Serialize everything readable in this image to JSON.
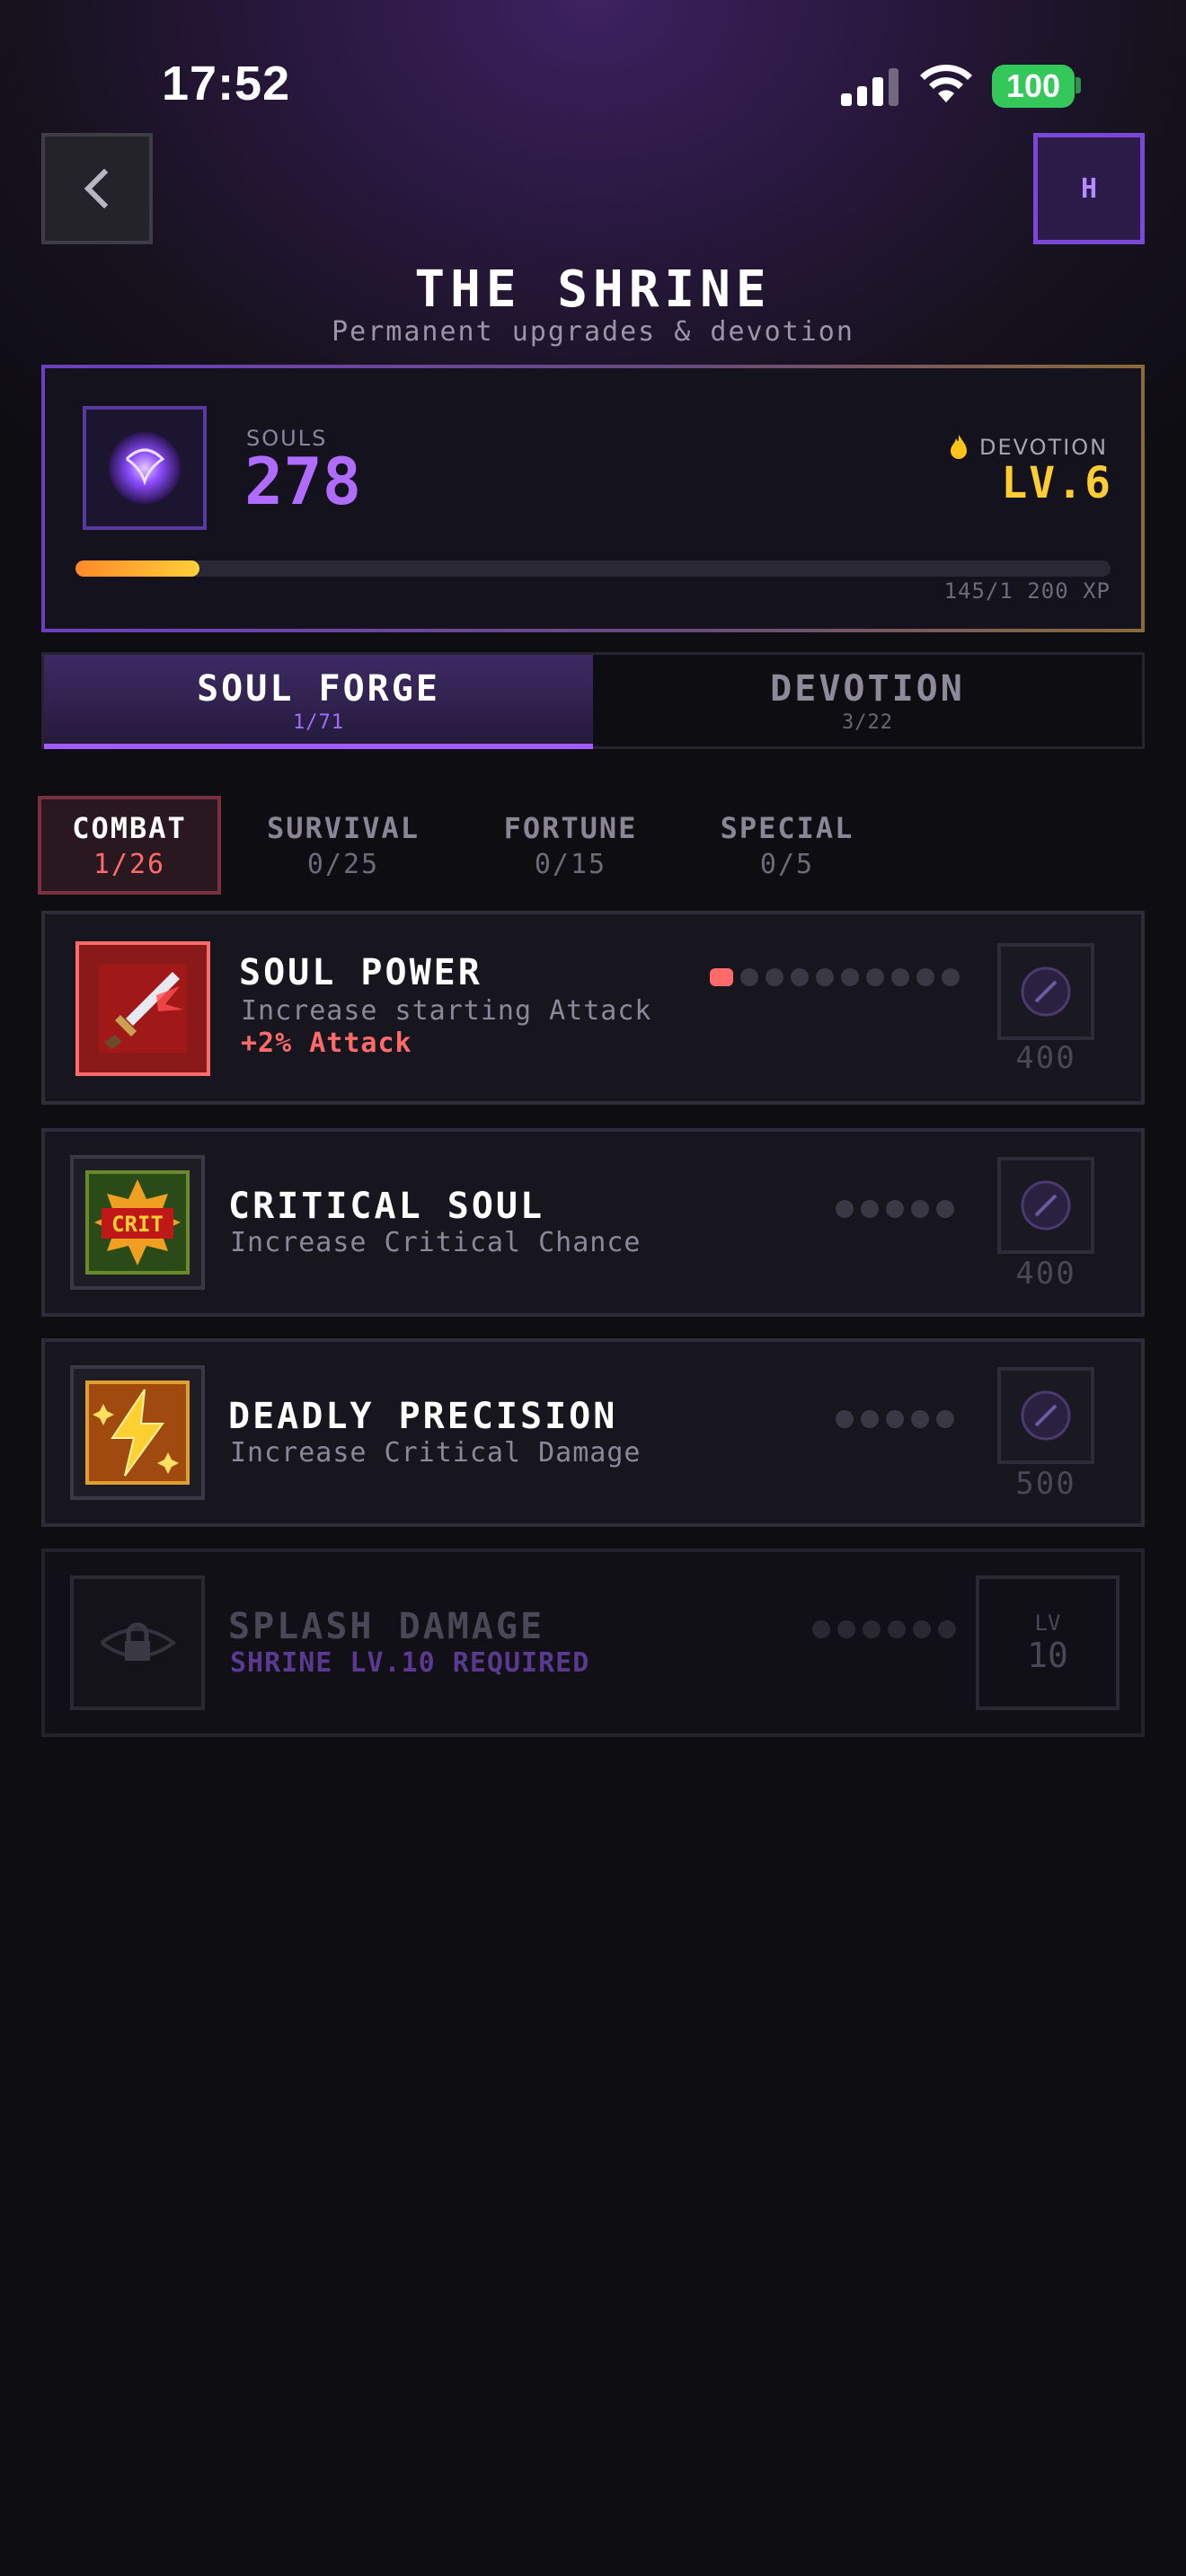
{
  "status": {
    "time": "17:52",
    "battery": "100"
  },
  "header": {
    "title": "THE SHRINE",
    "subtitle": "Permanent upgrades & devotion",
    "h_button": "H"
  },
  "souls": {
    "label": "SOULS",
    "value": "278"
  },
  "devotion": {
    "label": "DEVOTION",
    "level": "LV.6",
    "xp_text": "145/1 200 XP",
    "progress": 0.12
  },
  "main_tabs": [
    {
      "label": "SOUL FORGE",
      "count": "1/71",
      "active": true
    },
    {
      "label": "DEVOTION",
      "count": "3/22",
      "active": false
    }
  ],
  "categories": [
    {
      "label": "COMBAT",
      "count": "1/26",
      "active": true
    },
    {
      "label": "SURVIVAL",
      "count": "0/25",
      "active": false
    },
    {
      "label": "FORTUNE",
      "count": "0/15",
      "active": false
    },
    {
      "label": "SPECIAL",
      "count": "0/5",
      "active": false
    }
  ],
  "upgrades": [
    {
      "name": "SOUL POWER",
      "desc": "Increase starting Attack",
      "bonus": "+2% Attack",
      "level": 1,
      "max": 10,
      "cost": "400",
      "icon": "sword-icon"
    },
    {
      "name": "CRITICAL SOUL",
      "desc": "Increase Critical Chance",
      "level": 0,
      "max": 5,
      "cost": "400",
      "icon": "crit-icon",
      "icon_text": "CRIT"
    },
    {
      "name": "DEADLY PRECISION",
      "desc": "Increase Critical Damage",
      "level": 0,
      "max": 5,
      "cost": "500",
      "icon": "lightning-icon"
    },
    {
      "name": "SPLASH DAMAGE",
      "desc": "SHRINE LV.10 REQUIRED",
      "level": 0,
      "max": 6,
      "lv_label": "LV",
      "lv_value": "10",
      "locked": true,
      "icon": "lock-icon"
    }
  ]
}
